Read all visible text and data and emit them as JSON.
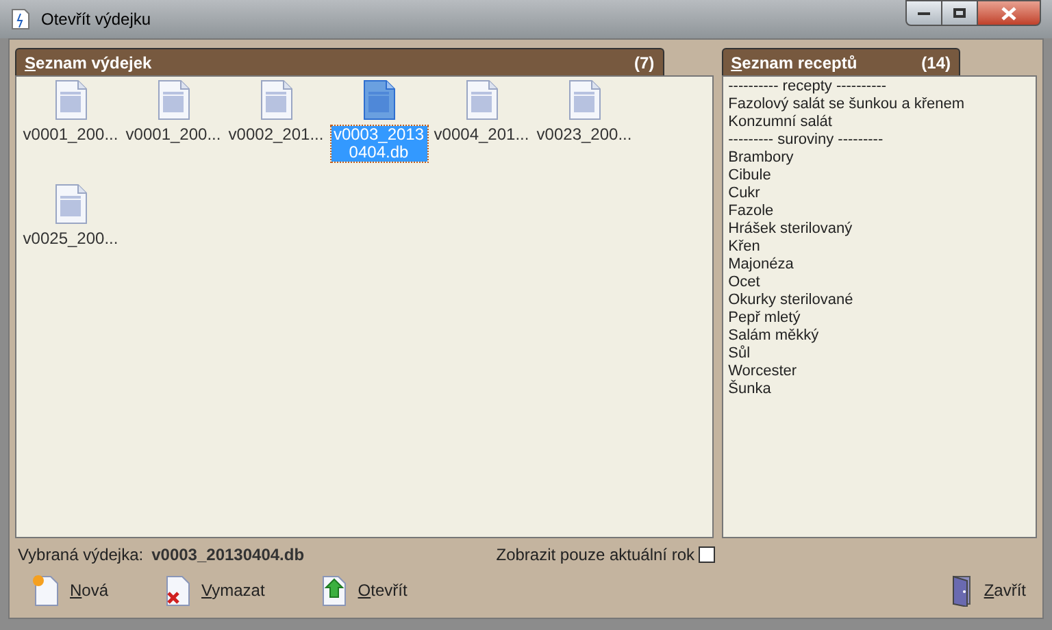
{
  "window": {
    "title": "Otevřít výdejku"
  },
  "issues_panel": {
    "title": "Seznam výdejek",
    "count": "(7)",
    "files": [
      {
        "name": "v0001_200...",
        "selected": false
      },
      {
        "name": "v0001_200...",
        "selected": false
      },
      {
        "name": "v0002_201...",
        "selected": false
      },
      {
        "name": "v0003_20130404.db",
        "selected": true
      },
      {
        "name": "v0004_201...",
        "selected": false
      },
      {
        "name": "v0023_200...",
        "selected": false
      },
      {
        "name": "v0025_200...",
        "selected": false
      }
    ]
  },
  "recipes_panel": {
    "title": "Seznam receptů",
    "count": "(14)",
    "items": [
      "---------- recepty ----------",
      "Fazolový salát se šunkou a křenem",
      "Konzumní salát",
      "--------- suroviny ---------",
      "Brambory",
      "Cibule",
      "Cukr",
      "Fazole",
      "Hrášek sterilovaný",
      "Křen",
      "Majonéza",
      "Ocet",
      "Okurky sterilované",
      "Pepř mletý",
      "Salám měkký",
      "Sůl",
      "Worcester",
      "Šunka"
    ]
  },
  "selected_label": "Vybraná výdejka:",
  "selected_value": "v0003_20130404.db",
  "current_year_only": {
    "label": "Zobrazit pouze aktuální rok",
    "checked": false
  },
  "buttons": [
    {
      "label": "Nová",
      "kind": "new"
    },
    {
      "label": "Vymazat",
      "kind": "delete"
    },
    {
      "label": "Otevřít",
      "kind": "open"
    }
  ],
  "close_button": {
    "label": "Zavřít"
  }
}
